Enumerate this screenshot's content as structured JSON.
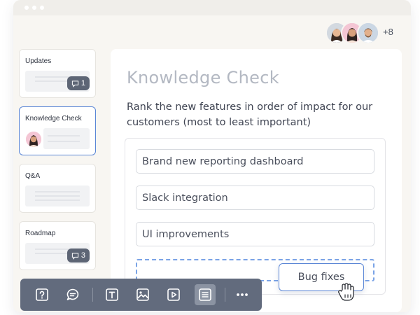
{
  "window": {
    "title_dots": 3
  },
  "header": {
    "collaborators": [
      {
        "icon": "woman-avatar"
      },
      {
        "icon": "woman-avatar-pink"
      },
      {
        "icon": "man-avatar"
      }
    ],
    "more_count": "+8"
  },
  "sidebar": {
    "slides": [
      {
        "title": "Updates",
        "comment_count": "1"
      },
      {
        "title": "Knowledge Check",
        "active": true
      },
      {
        "title": "Q&A"
      },
      {
        "title": "Roadmap",
        "comment_count": "3"
      }
    ]
  },
  "main": {
    "title": "Knowledge Check",
    "question": "Rank the new features in order of impact for our customers (most to least important)",
    "rank_items": [
      "Brand new reporting dashboard",
      "Slack integration",
      "UI improvements"
    ],
    "dragging_item": "Bug fixes"
  },
  "toolbar": {
    "buttons": [
      {
        "icon": "question-icon"
      },
      {
        "icon": "chat-bubble-icon"
      },
      {
        "icon": "text-icon"
      },
      {
        "icon": "image-icon"
      },
      {
        "icon": "video-icon"
      },
      {
        "icon": "list-icon",
        "active": true
      },
      {
        "icon": "more-icon"
      }
    ]
  },
  "colors": {
    "accent": "#5a86d6",
    "toolbar_bg": "#626b7d",
    "badge_bg": "#5d6575",
    "title_gray": "#b3b8c2"
  }
}
